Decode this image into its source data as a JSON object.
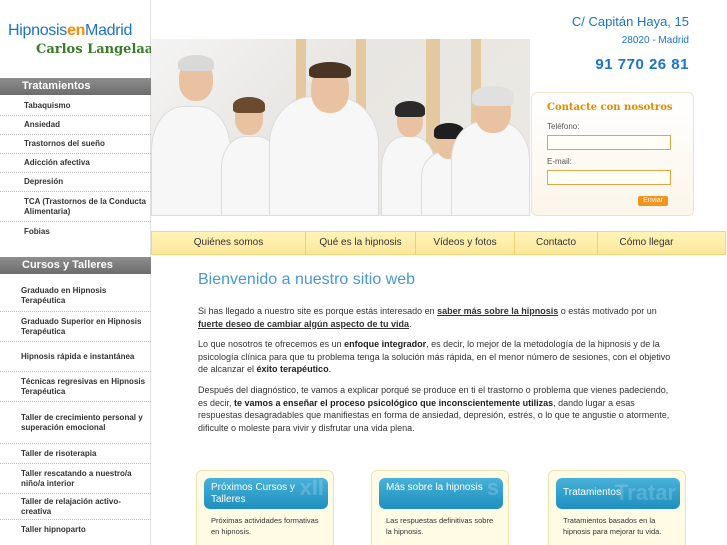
{
  "logo": {
    "line1_a": "Hipnosis",
    "line1_b": "en",
    "line1_c": "Madrid",
    "line2": "Carlos Langelaan"
  },
  "header": {
    "address": "C/ Capitán Haya, 15",
    "zip": "28020 - Madrid",
    "phone": "91 770 26 81"
  },
  "sidebar": {
    "tratamientos_title": "Tratamientos",
    "tratamientos": [
      "Tabaquismo",
      "Ansiedad",
      "Trastornos del sueño",
      "Adicción afectiva",
      "Depresión",
      "TCA (Trastornos de la Conducta Alimentaria)",
      "Fobias"
    ],
    "cursos_title": "Cursos y Talleres",
    "cursos": [
      "Graduado en Hipnosis Terapéutica",
      "Graduado Superior en Hipnosis Terapéutica",
      "Hipnosis rápida e instantánea",
      "Técnicas regresivas en Hipnosis Terapéutica",
      "Taller de crecimiento personal y superación emocional",
      "Taller de risoterapia",
      "Taller rescatando a nuestro/a niño/a interior",
      "Taller de relajación activo-creativa",
      "Taller hipnoparto"
    ]
  },
  "contact_form": {
    "title": "Contacte con nosotros",
    "phone_label": "Teléfono:",
    "email_label": "E-mail:",
    "phone_value": "",
    "email_value": "",
    "send_label": "Enviar"
  },
  "topnav": [
    "Quiénes somos",
    "Qué es la hipnosis",
    "Vídeos y fotos",
    "Contacto",
    "Cómo llegar"
  ],
  "main": {
    "heading": "Bienvenido a nuestro sitio web",
    "p1_a": "Si has llegado a nuestro site es porque estás interesado en ",
    "p1_link1": "saber más sobre la hipnosis",
    "p1_b": " o estás motivado por un ",
    "p1_link2": "fuerte deseo de cambiar algún aspecto de tu vida",
    "p1_c": ".",
    "p2_a": "Lo que nosotros te ofrecemos es un ",
    "p2_bold1": "enfoque integrador",
    "p2_b": ", es decir, lo mejor de la metodología de la hipnosis y de la psicología clínica para que tu problema tenga la solución más rápida, en el menor número de sesiones, con el objetivo de alcanzar el ",
    "p2_bold2": "éxito terapéutico",
    "p2_c": ".",
    "p3_a": "Después del diagnóstico, te vamos a explicar porqué se produce en ti el trastorno o problema que vienes padeciendo, es decir, ",
    "p3_bold": "te vamos a enseñar el proceso psicológico que inconscientemente utilizas",
    "p3_b": ", dando lugar a esas respuestas desagradables que manifiestas en forma de ansiedad, depresión, estrés, o lo que te angustie o atormente, dificulte o moleste para vivir y disfrutar una vida plena."
  },
  "cards": [
    {
      "title": "Próximos Cursos y Talleres",
      "text": "Próximas actividades formativas en hipnosis."
    },
    {
      "title": "Más sobre la hipnosis",
      "text": "Las respuestas definitivas sobre la hipnosis."
    },
    {
      "title": "Tratamientos",
      "text": "Tratamientos basados en la hipnosis para mejorar tu vida."
    }
  ],
  "colors": {
    "brand_blue": "#1a73c8",
    "accent_orange": "#ff8a00",
    "menu_yellow": "#fff4b8",
    "card_blue": "#2a9ccc"
  }
}
